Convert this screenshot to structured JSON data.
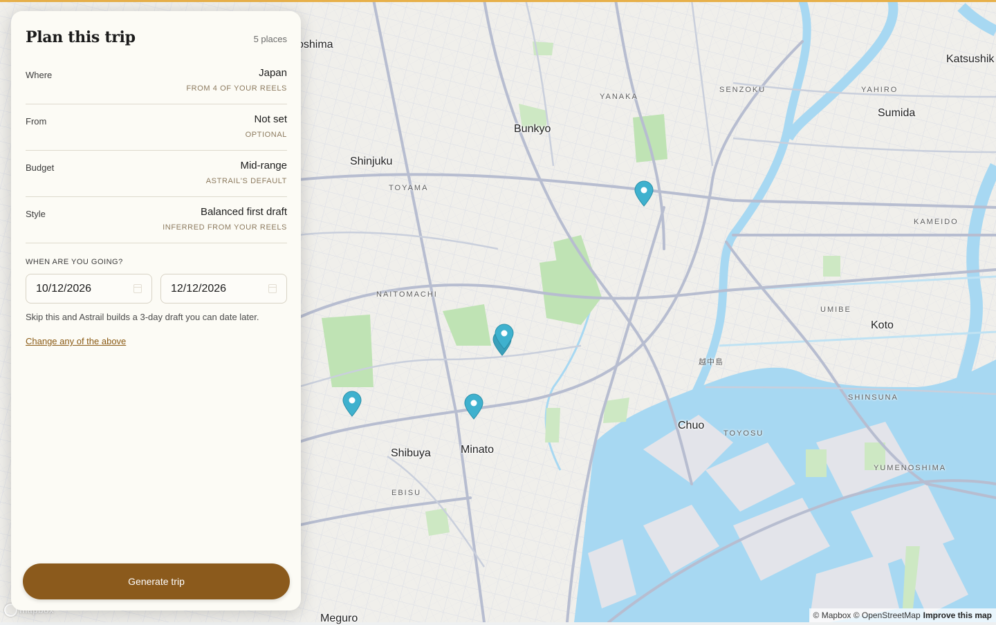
{
  "panel": {
    "title": "Plan this trip",
    "place_count": "5 places",
    "rows": [
      {
        "label": "Where",
        "value": "Japan",
        "sub": "FROM 4 OF YOUR REELS"
      },
      {
        "label": "From",
        "value": "Not set",
        "sub": "OPTIONAL"
      },
      {
        "label": "Budget",
        "value": "Mid-range",
        "sub": "ASTRAIL'S DEFAULT"
      },
      {
        "label": "Style",
        "value": "Balanced first draft",
        "sub": "INFERRED FROM YOUR REELS"
      }
    ],
    "dates": {
      "title": "WHEN ARE YOU GOING?",
      "start": "10/12/2026",
      "end": "12/12/2026",
      "hint": "Skip this and Astrail builds a 3-day draft you can date later."
    },
    "change_link": "Change any of the above",
    "generate_button": "Generate trip"
  },
  "map": {
    "labels": {
      "toshima": "oshima",
      "katsushika": "Katsushik",
      "bunkyo": "Bunkyo",
      "sumida": "Sumida",
      "shinjuku": "Shinjuku",
      "koto": "Koto",
      "chuo": "Chuo",
      "shibuya": "Shibuya",
      "minato": "Minato",
      "meguro": "Meguro"
    },
    "districts": {
      "yanaka": "YANAKA",
      "senzoku": "SENZOKU",
      "yahiro": "YAHIRO",
      "toyama": "TOYAMA",
      "kameido": "KAMEIDO",
      "naitomachi": "NAITOMACHI",
      "umibe": "UMIBE",
      "etchujima": "越中島",
      "shinsuna": "SHINSUNA",
      "toyosu": "TOYOSU",
      "yumenoshima": "YUMENOSHIMA",
      "ebisu": "EBISU"
    },
    "attribution": "© Mapbox © OpenStreetMap",
    "improve_link": "Improve this map",
    "logo": "mapbox",
    "pin_color": "#3fb1ce"
  }
}
